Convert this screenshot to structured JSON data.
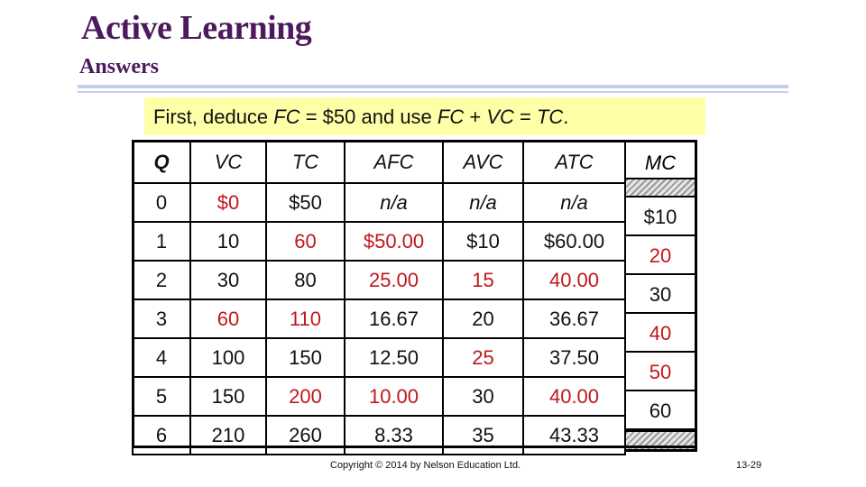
{
  "header": {
    "title": "Active Learning",
    "subtitle": "Answers"
  },
  "note": {
    "prefix": "First, deduce ",
    "fc1": "FC",
    "mid1": " = $50 and use ",
    "fc2": "FC",
    "plus": " + ",
    "vc": "VC",
    "eq": " = ",
    "tc": "TC",
    "end": "."
  },
  "table": {
    "columns": [
      "Q",
      "VC",
      "TC",
      "AFC",
      "AVC",
      "ATC",
      "MC"
    ],
    "rows": [
      {
        "Q": "0",
        "VC": "$0",
        "TC": "$50",
        "AFC": "n/a",
        "AVC": "n/a",
        "ATC": "n/a"
      },
      {
        "Q": "1",
        "VC": "10",
        "TC": "60",
        "AFC": "$50.00",
        "AVC": "$10",
        "ATC": "$60.00"
      },
      {
        "Q": "2",
        "VC": "30",
        "TC": "80",
        "AFC": "25.00",
        "AVC": "15",
        "ATC": "40.00"
      },
      {
        "Q": "3",
        "VC": "60",
        "TC": "110",
        "AFC": "16.67",
        "AVC": "20",
        "ATC": "36.67"
      },
      {
        "Q": "4",
        "VC": "100",
        "TC": "150",
        "AFC": "12.50",
        "AVC": "25",
        "ATC": "37.50"
      },
      {
        "Q": "5",
        "VC": "150",
        "TC": "200",
        "AFC": "10.00",
        "AVC": "30",
        "ATC": "40.00"
      },
      {
        "Q": "6",
        "VC": "210",
        "TC": "260",
        "AFC": "8.33",
        "AVC": "35",
        "ATC": "43.33"
      }
    ],
    "mc_values": [
      "$10",
      "20",
      "30",
      "40",
      "50",
      "60"
    ],
    "highlight_color": "#c0171c"
  },
  "footer": {
    "copyright": "Copyright © 2014 by Nelson Education Ltd.",
    "page": "13-29"
  }
}
